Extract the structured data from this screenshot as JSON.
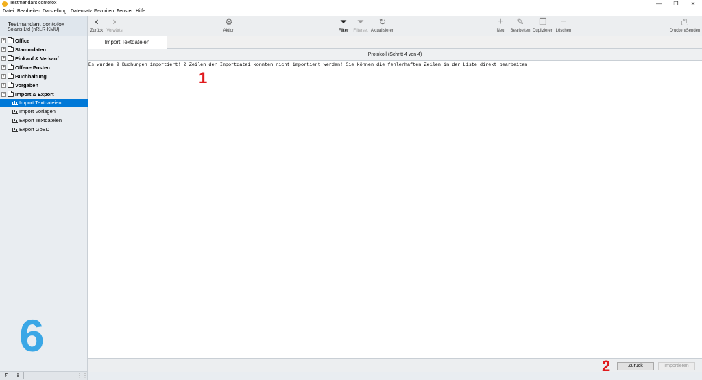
{
  "window": {
    "title": "Testmandant contofox",
    "controls": {
      "minimize": "—",
      "maximize": "❐",
      "close": "✕"
    }
  },
  "menu": [
    "Datei",
    "Bearbeiten",
    "Darstellung",
    "Datensatz",
    "Favoriten",
    "Fenster",
    "Hilfe"
  ],
  "sidebar": {
    "company": "Testmandant contofox",
    "company_sub": "Solaris Ltd  (nRLR-KMU)",
    "tree": [
      {
        "label": "Office",
        "expander": "+"
      },
      {
        "label": "Stammdaten",
        "expander": "+"
      },
      {
        "label": "Einkauf & Verkauf",
        "expander": "+"
      },
      {
        "label": "Offene Posten",
        "expander": "+"
      },
      {
        "label": "Buchhaltung",
        "expander": "+"
      },
      {
        "label": "Vorgaben",
        "expander": "+"
      },
      {
        "label": "Import & Export",
        "expander": "−"
      }
    ],
    "children": [
      {
        "label": "Import Textdateien",
        "selected": true
      },
      {
        "label": "Import Vorlagen",
        "selected": false
      },
      {
        "label": "Export Textdateien",
        "selected": false
      },
      {
        "label": "Export GoBD",
        "selected": false
      }
    ],
    "marker": "6",
    "footer": {
      "sum": "Σ",
      "info": "i",
      "grip": "⋮⋮"
    }
  },
  "toolbar": {
    "back": {
      "label": "Zurück",
      "icon": "‹"
    },
    "forward": {
      "label": "Vorwärts",
      "icon": "›"
    },
    "action": {
      "label": "Aktion",
      "icon": "⚙"
    },
    "filter": {
      "label": "Filter",
      "icon": "⏷"
    },
    "filterset": {
      "label": "Filterset",
      "icon": "⏷"
    },
    "refresh": {
      "label": "Aktualisieren",
      "icon": "↻"
    },
    "new": {
      "label": "Neu",
      "icon": "+"
    },
    "edit": {
      "label": "Bearbeiten",
      "icon": "✎"
    },
    "duplicate": {
      "label": "Duplizieren",
      "icon": "❐"
    },
    "delete": {
      "label": "Löschen",
      "icon": "−"
    },
    "print": {
      "label": "Drucken/Senden",
      "icon": "⎙"
    }
  },
  "tabs": [
    {
      "label": "Import Textdateien"
    }
  ],
  "content": {
    "header": "Protokoll (Schritt 4 von 4)",
    "log": "Es wurden 9 Buchungen importiert! 2 Zeilen der Importdatei konnten nicht importiert werden! Sie können die fehlerhaften Zeilen in der Liste direkt bearbeiten",
    "marker_1": "1",
    "marker_2": "2"
  },
  "buttons": {
    "back": "Zurück",
    "import": "Importieren"
  },
  "colors": {
    "selection": "#0078d7",
    "marker_red": "#e0191c",
    "marker_blue": "#3aa7e6",
    "sidebar_bg": "#e9edf1"
  }
}
